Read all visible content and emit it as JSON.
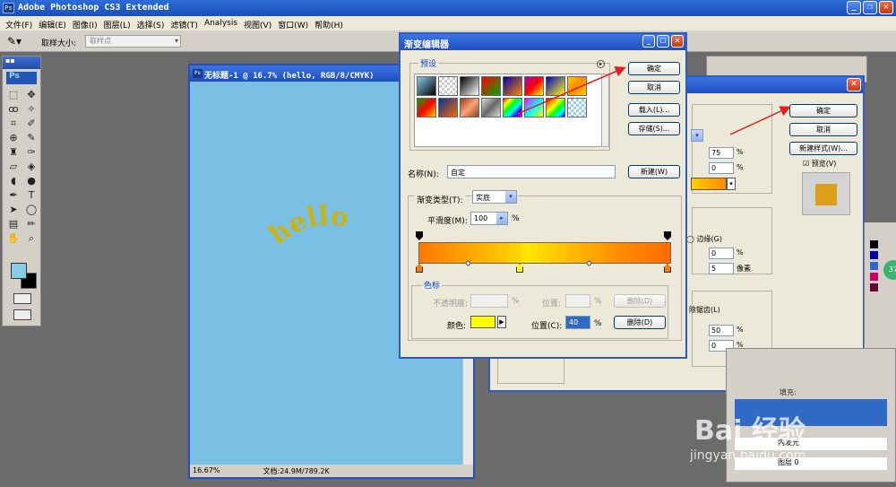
{
  "app": {
    "title": "Adobe Photoshop CS3 Extended",
    "logo": "Ps"
  },
  "menubar": [
    "文件(F)",
    "编辑(E)",
    "图像(I)",
    "图层(L)",
    "选择(S)",
    "滤镜(T)",
    "Analysis",
    "视图(V)",
    "窗口(W)",
    "帮助(H)"
  ],
  "options_bar": {
    "sample_size_label": "取样大小:",
    "sample_size_value": "取样点"
  },
  "toolbox": {
    "badge": "Ps"
  },
  "document": {
    "title": "无标题-1 @ 16.7% (hello, RGB/8/CMYK)",
    "canvas_text": "hello",
    "canvas_color": "#7ac0e5",
    "text_color": "#c8b418",
    "zoom": "16.67%",
    "doc_info": "文档:24.9M/789.2K"
  },
  "gradient_editor": {
    "title": "渐变编辑器",
    "presets_label": "预设",
    "ok_label": "确定",
    "cancel_label": "取消",
    "load_label": "载入(L)...",
    "save_label": "存储(S)...",
    "name_label": "名称(N):",
    "name_value": "自定",
    "new_label": "新建(W)",
    "type_label": "渐变类型(T):",
    "type_value": "实底",
    "smoothness_label": "平滑度(M):",
    "smoothness_value": "100",
    "smoothness_unit": "%",
    "stops_label": "色标",
    "opacity_label": "不透明度:",
    "opacity_unit": "%",
    "opacity_location_label": "位置:",
    "opacity_location_unit": "%",
    "opacity_delete_label": "删除(D)",
    "color_label": "颜色:",
    "color_location_label": "位置(C):",
    "color_location_value": "40",
    "color_location_unit": "%",
    "color_delete_label": "删除(D)",
    "selected_color": "#ffff00"
  },
  "layer_style": {
    "ok_label": "确定",
    "cancel_label": "取消",
    "new_style_label": "新建样式(W)...",
    "preview_label": "预览(V)",
    "field1": "75",
    "field2": "0",
    "edge_label": "边缘(G)",
    "field3": "0",
    "field4": "5",
    "pixel_unit": "像素",
    "antialias_label": "除锯齿(L)",
    "field5": "50",
    "field6": "0",
    "percent": "%"
  },
  "layers": {
    "inner_glow": "内发光",
    "layer0": "图层 0",
    "fill_label": "填充:"
  },
  "watermark": {
    "brand": "Bai 经验",
    "site": "jingyan.baidu.com",
    "badge": "37"
  }
}
